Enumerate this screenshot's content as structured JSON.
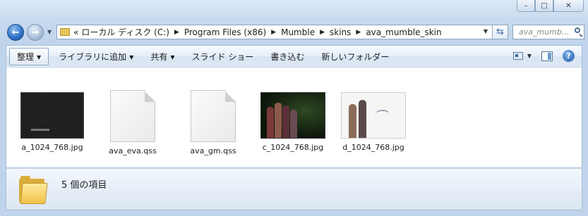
{
  "window": {
    "minimize_glyph": "–",
    "maximize_glyph": "□",
    "close_glyph": "✕"
  },
  "nav": {
    "back_glyph": "←",
    "forward_glyph": "→",
    "overflow": "«",
    "breadcrumbs": [
      "ローカル ディスク (C:)",
      "Program Files (x86)",
      "Mumble",
      "skins",
      "ava_mumble_skin"
    ],
    "search_placeholder": "ava_mumb..."
  },
  "toolbar": {
    "organize": "整理",
    "add_to_library": "ライブラリに追加",
    "share": "共有",
    "slideshow": "スライド ショー",
    "burn": "書き込む",
    "new_folder": "新しいフォルダー",
    "help_glyph": "?"
  },
  "files": [
    {
      "name": "a_1024_768.jpg",
      "kind": "image-dark"
    },
    {
      "name": "ava_eva.qss",
      "kind": "document"
    },
    {
      "name": "ava_gm.qss",
      "kind": "document"
    },
    {
      "name": "c_1024_768.jpg",
      "kind": "image-green"
    },
    {
      "name": "d_1024_768.jpg",
      "kind": "image-white"
    }
  ],
  "details": {
    "count_text": "5 個の項目"
  },
  "colors": {
    "frame": "#c6d9ee",
    "folder": "#f0c24c",
    "accent": "#2b6fc4"
  }
}
